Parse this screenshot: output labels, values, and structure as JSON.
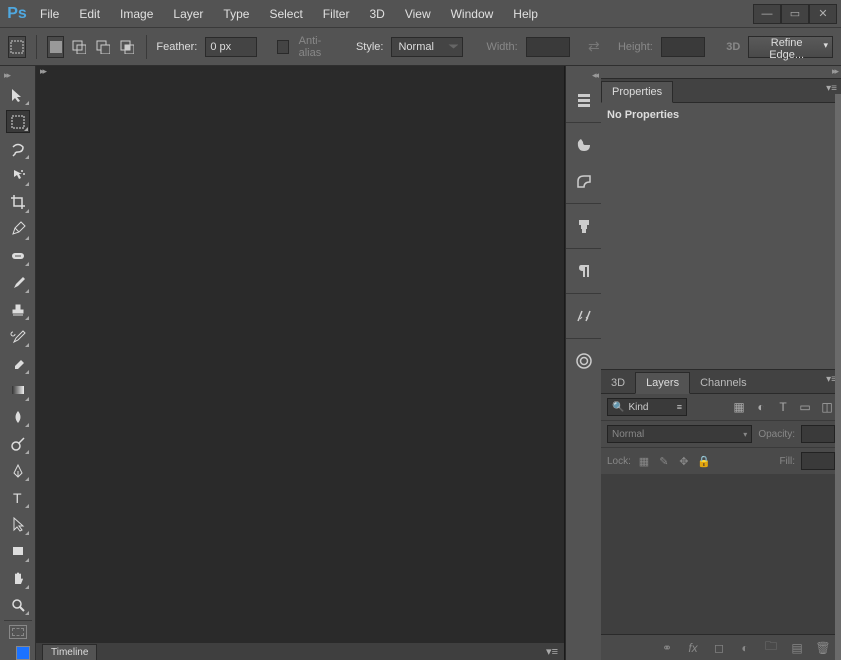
{
  "menubar": {
    "items": [
      "File",
      "Edit",
      "Image",
      "Layer",
      "Type",
      "Select",
      "Filter",
      "3D",
      "View",
      "Window",
      "Help"
    ]
  },
  "options": {
    "feather_label": "Feather:",
    "feather_value": "0 px",
    "antialias_label": "Anti-alias",
    "style_label": "Style:",
    "style_value": "Normal",
    "width_label": "Width:",
    "height_label": "Height:",
    "refine_label": "Refine Edge..."
  },
  "tools": [
    "move-tool",
    "marquee-tool",
    "lasso-tool",
    "quick-select-tool",
    "crop-tool",
    "eyedropper-tool",
    "healing-brush-tool",
    "brush-tool",
    "stamp-tool",
    "history-brush-tool",
    "eraser-tool",
    "gradient-tool",
    "blur-tool",
    "dodge-tool",
    "pen-tool",
    "type-tool",
    "path-select-tool",
    "rectangle-tool",
    "hand-tool",
    "zoom-tool"
  ],
  "dock": [
    "history-icon",
    "color-icon",
    "swatches-icon",
    "brush-settings-icon",
    "paragraph-icon",
    "properties-icon",
    "cc-libraries-icon"
  ],
  "panels": {
    "properties": {
      "tab": "Properties",
      "body": "No Properties"
    },
    "layers_tabs": [
      "3D",
      "Layers",
      "Channels"
    ],
    "filter_mode": "Kind",
    "blend_mode": "Normal",
    "opacity_label": "Opacity:",
    "lock_label": "Lock:",
    "fill_label": "Fill:"
  },
  "timeline": {
    "tab": "Timeline"
  },
  "threed_label": "3D"
}
